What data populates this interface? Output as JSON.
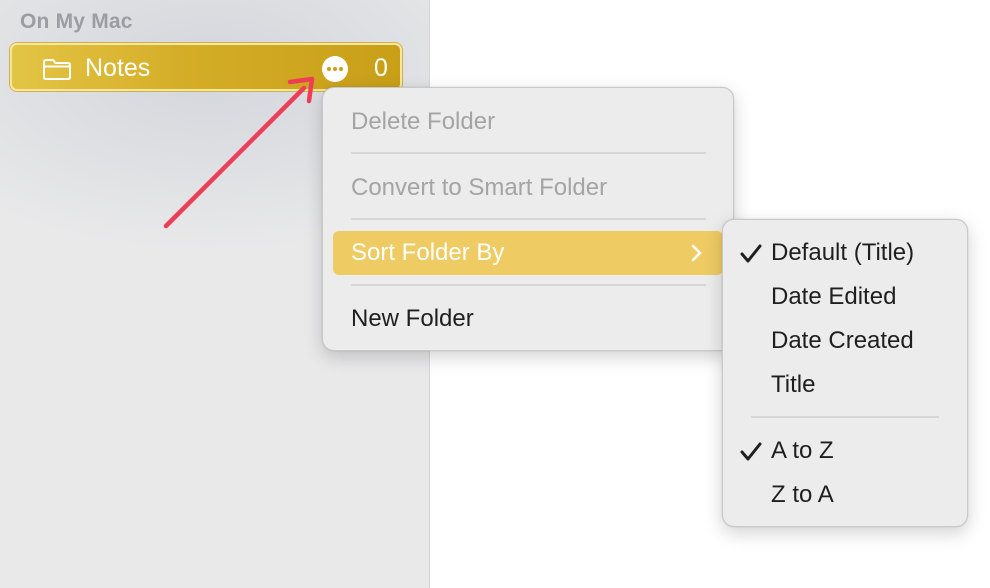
{
  "sidebar": {
    "section_label": "On My Mac",
    "folder": {
      "name": "Notes",
      "count": "0",
      "icon": "folder-icon",
      "more_icon": "ellipsis-circle-icon"
    }
  },
  "context_menu": {
    "items": [
      {
        "label": "Delete Folder",
        "enabled": false
      },
      {
        "label": "Convert to Smart Folder",
        "enabled": false
      },
      {
        "label": "Sort Folder By",
        "enabled": true,
        "highlighted": true,
        "has_submenu": true
      },
      {
        "label": "New Folder",
        "enabled": true
      }
    ]
  },
  "submenu": {
    "sort_fields": [
      {
        "label": "Default (Title)",
        "checked": true
      },
      {
        "label": "Date Edited",
        "checked": false
      },
      {
        "label": "Date Created",
        "checked": false
      },
      {
        "label": "Title",
        "checked": false
      }
    ],
    "sort_orders": [
      {
        "label": "A to Z",
        "checked": true
      },
      {
        "label": "Z to A",
        "checked": false
      }
    ]
  },
  "colors": {
    "folder_highlight": "#d4ad27",
    "menu_highlight": "#efcb63",
    "annotation_arrow": "#ee3d55"
  }
}
